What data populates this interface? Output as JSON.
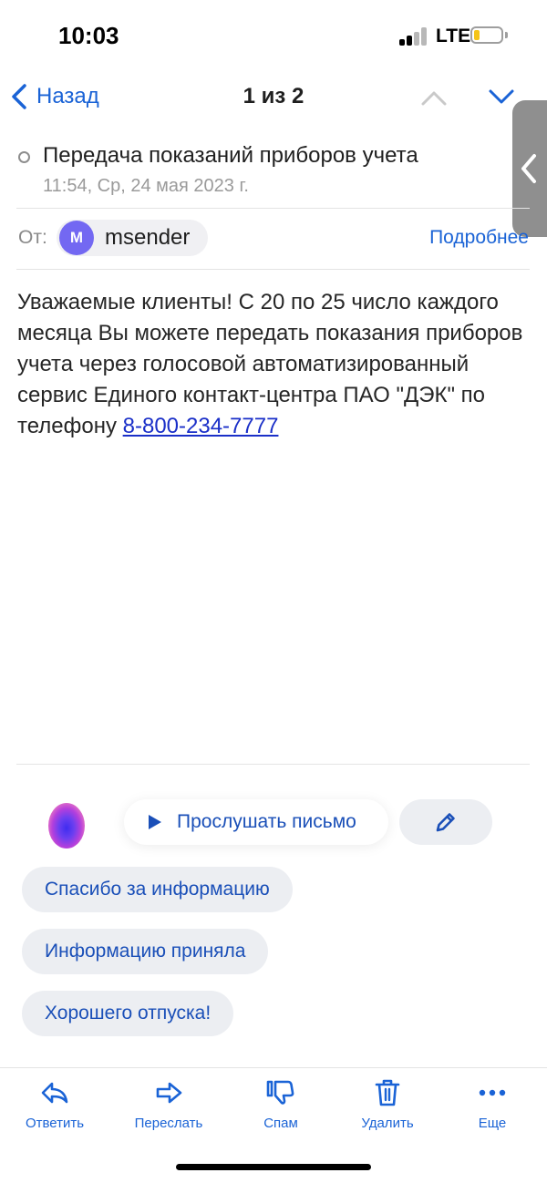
{
  "status_bar": {
    "time": "10:03",
    "network": "LTE",
    "battery_level": 0.2
  },
  "nav": {
    "back_label": "Назад",
    "counter": "1 из 2"
  },
  "message": {
    "subject": "Передача показаний приборов учета",
    "date": "11:54, Ср, 24 мая 2023 г.",
    "from_label": "От:",
    "sender_initial": "M",
    "sender_name": "msender",
    "details_label": "Подробнее",
    "body_text": "Уважаемые клиенты! С 20 по 25 число каждого месяца Вы можете передать показания приборов учета через голосовой автоматизированный сервис Единого контакт-центра ПАО \"ДЭК\" по телефону ",
    "phone": "8-800-234-7777"
  },
  "assistant": {
    "listen_label": "Прослушать письмо"
  },
  "quick_replies": [
    "Спасибо за информацию",
    "Информацию приняла",
    "Хорошего отпуска!"
  ],
  "toolbar": {
    "reply_label": "Ответить",
    "forward_label": "Переслать",
    "spam_label": "Спам",
    "delete_label": "Удалить",
    "more_label": "Еще"
  },
  "colors": {
    "accent": "#1a63d6",
    "avatar": "#7368f2",
    "link": "#1a2fc8"
  }
}
